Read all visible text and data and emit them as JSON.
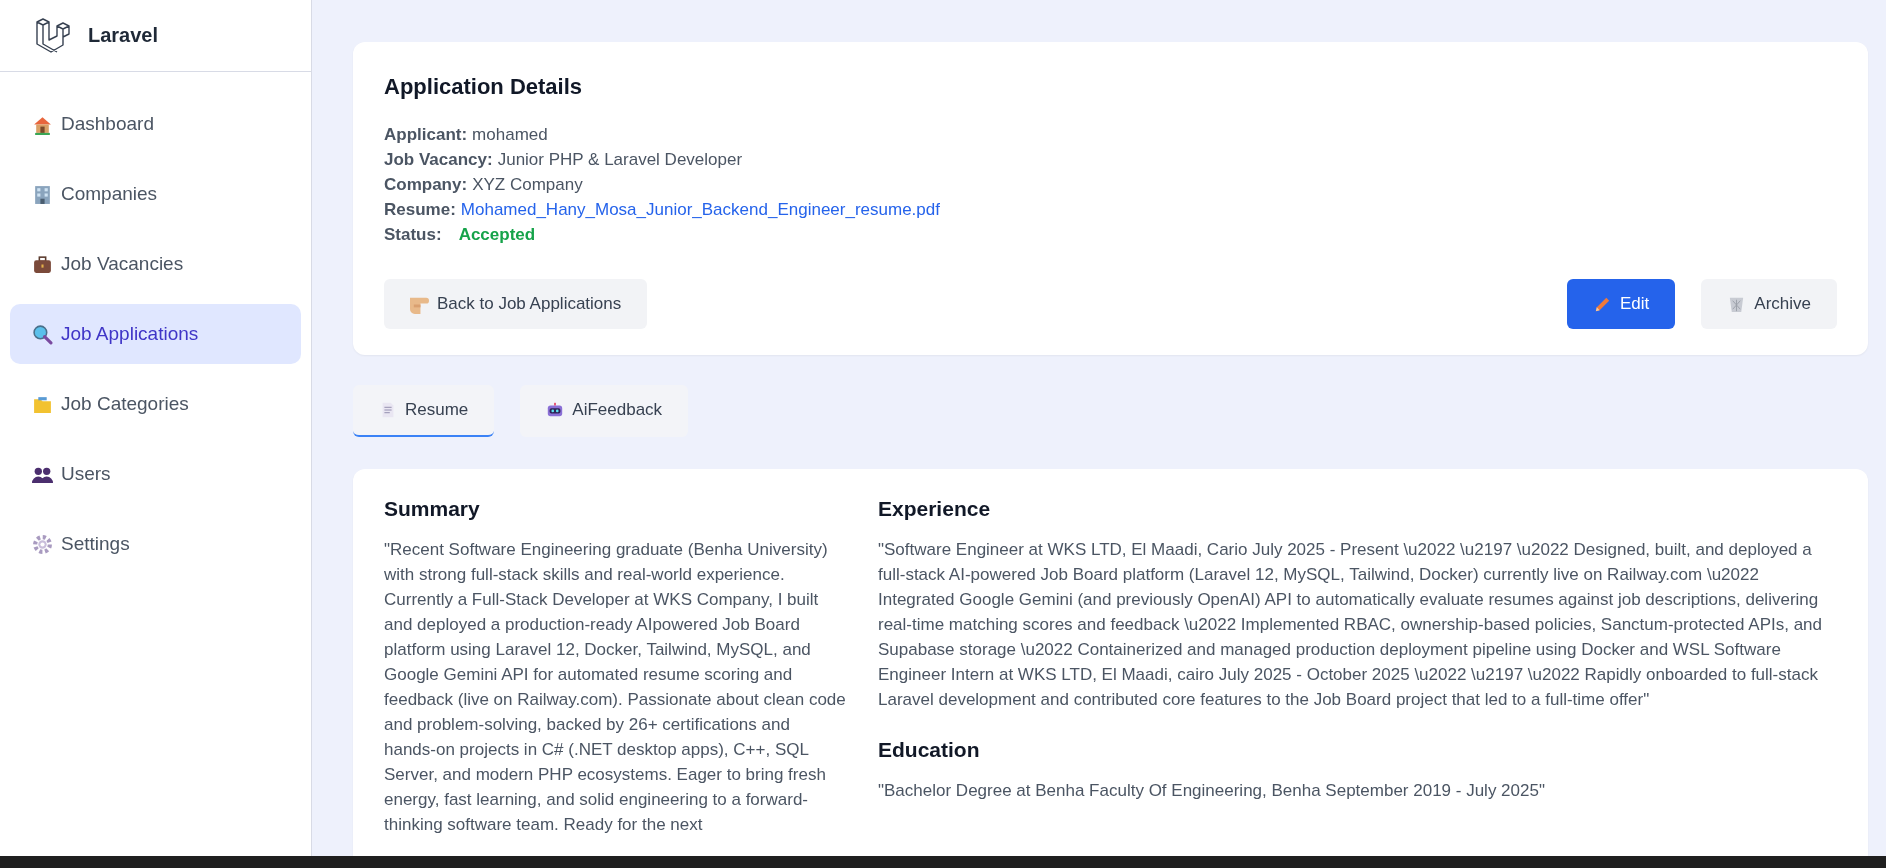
{
  "brand": {
    "name": "Laravel"
  },
  "sidebar": {
    "items": [
      {
        "label": "Dashboard",
        "selected": false
      },
      {
        "label": "Companies",
        "selected": false
      },
      {
        "label": "Job Vacancies",
        "selected": false
      },
      {
        "label": "Job Applications",
        "selected": true
      },
      {
        "label": "Job Categories",
        "selected": false
      },
      {
        "label": "Users",
        "selected": false
      },
      {
        "label": "Settings",
        "selected": false
      }
    ]
  },
  "details": {
    "title": "Application Details",
    "fields": [
      {
        "label": "Applicant:",
        "value": "mohamed",
        "kind": "text"
      },
      {
        "label": "Job Vacancy:",
        "value": "Junior PHP & Laravel Developer",
        "kind": "text"
      },
      {
        "label": "Company:",
        "value": "XYZ Company",
        "kind": "text"
      },
      {
        "label": "Resume:",
        "value": "Mohamed_Hany_Mosa_Junior_Backend_Engineer_resume.pdf",
        "kind": "link"
      },
      {
        "label": "Status:",
        "value": "Accepted",
        "kind": "status"
      }
    ],
    "back_button": "Back to Job Applications",
    "edit_button": "Edit",
    "archive_button": "Archive"
  },
  "tabs": [
    {
      "label": "Resume",
      "selected": true
    },
    {
      "label": "AiFeedback",
      "selected": false
    }
  ],
  "resume": {
    "summary": {
      "title": "Summary",
      "text": "\"Recent Software Engineering graduate (Benha University) with strong full-stack skills and real-world experience. Currently a Full-Stack Developer at WKS Company, I built and deployed a production-ready AIpowered Job Board platform using Laravel 12, Docker, Tailwind, MySQL, and Google Gemini API for automated resume scoring and feedback (live on Railway.com). Passionate about clean code and problem-solving, backed by 26+ certifications and hands-on projects in C# (.NET desktop apps), C++, SQL Server, and modern PHP ecosystems. Eager to bring fresh energy, fast learning, and solid engineering to a forward-thinking software team. Ready for the next"
    },
    "experience": {
      "title": "Experience",
      "text": "\"Software Engineer at WKS LTD, El Maadi, Cario July 2025 - Present \\u2022 \\u2197 \\u2022 Designed, built, and deployed a full-stack AI-powered Job Board platform (Laravel 12, MySQL, Tailwind, Docker) currently live on Railway.com \\u2022 Integrated Google Gemini (and previously OpenAI) API to automatically evaluate resumes against job descriptions, delivering real-time matching scores and feedback \\u2022 Implemented RBAC, ownership-based policies, Sanctum-protected APIs, and Supabase storage \\u2022 Containerized and managed production deployment pipeline using Docker and WSL Software Engineer Intern at WKS LTD, El Maadi, cairo July 2025 - October 2025 \\u2022 \\u2197 \\u2022 Rapidly onboarded to full-stack Laravel development and contributed core features to the Job Board project that led to a full-time offer\""
    },
    "education": {
      "title": "Education",
      "text": "\"Bachelor Degree at Benha Faculty Of Engineering, Benha September 2019 - July 2025\""
    }
  }
}
